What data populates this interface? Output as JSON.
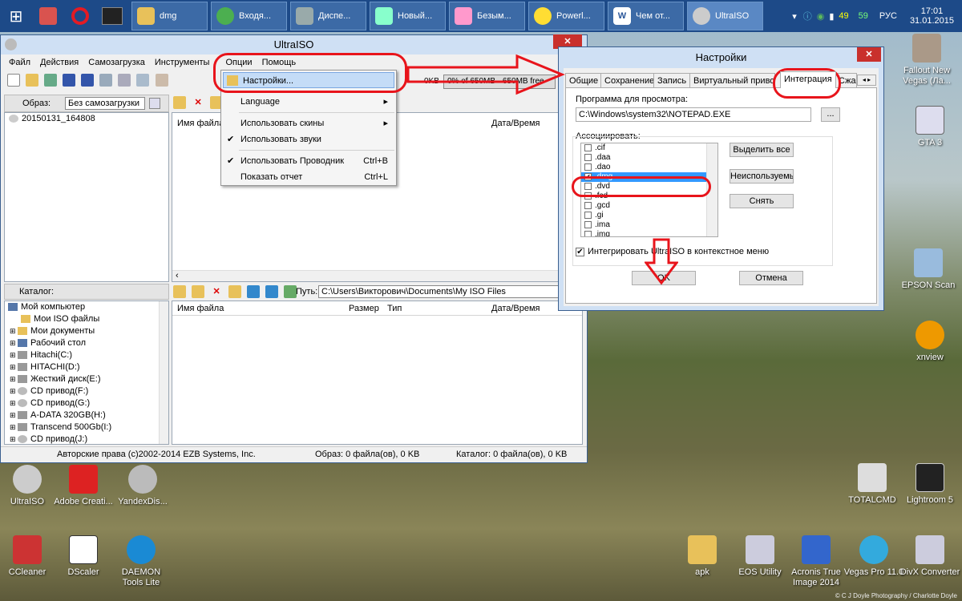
{
  "taskbar": {
    "tasks": [
      "dmg",
      "Входя...",
      "Диспе...",
      "Новый...",
      "Безым...",
      "Powerl...",
      "Чем от...",
      "UltraISO"
    ],
    "tray": {
      "lang": "РУС",
      "time": "17:01",
      "date": "31.01.2015",
      "n1": "49",
      "n2": "59"
    }
  },
  "ultraiso": {
    "title": "UltraISO",
    "menu": [
      "Файл",
      "Действия",
      "Самозагрузка",
      "Инструменты",
      "Опции",
      "Помощь"
    ],
    "image_label": "Образ:",
    "image_value": "Без самозагрузки",
    "size_label": "0KB",
    "size_bar": "0% of 650MB - 650MB free",
    "top_tree_item": "20150131_164808",
    "file_headers": [
      "Имя файла",
      "Размер",
      "Тип",
      "Дата/Время"
    ],
    "catalog_label": "Каталог:",
    "path_label": "Путь:",
    "path_value": "C:\\Users\\Викторович\\Documents\\My ISO Files",
    "tree": [
      "Мой компьютер",
      "Мои ISO файлы",
      "Мои документы",
      "Рабочий стол",
      "Hitachi(C:)",
      "HITACHI(D:)",
      "Жесткий диск(E:)",
      "CD привод(F:)",
      "CD привод(G:)",
      "A-DATA 320GB(H:)",
      "Transcend 500Gb(I:)",
      "CD привод(J:)"
    ],
    "status": {
      "copyright": "Авторские права (c)2002-2014 EZB Systems, Inc.",
      "image": "Образ: 0 файла(ов), 0 KB",
      "catalog": "Каталог: 0 файла(ов), 0 KB"
    }
  },
  "options_menu": {
    "settings": "Настройки...",
    "language": "Language",
    "use_skins": "Использовать скины",
    "use_sounds": "Использовать звуки",
    "use_explorer": "Использовать Проводник",
    "use_explorer_sc": "Ctrl+B",
    "show_report": "Показать отчет",
    "show_report_sc": "Ctrl+L"
  },
  "settings_dialog": {
    "title": "Настройки",
    "tabs": [
      "Общие",
      "Сохранение",
      "Запись",
      "Виртуальный привод",
      "Интеграция",
      "Сжа"
    ],
    "viewer_label": "Программа для просмотра:",
    "viewer_value": "C:\\Windows\\system32\\NOTEPAD.EXE",
    "browse": "...",
    "assoc_label": "Ассоциировать:",
    "extensions": [
      ".cif",
      ".daa",
      ".dao",
      ".dmg",
      ".dvd",
      ".fcd",
      ".gcd",
      ".gi",
      ".ima",
      ".img"
    ],
    "select_all": "Выделить все",
    "unused": "Неиспользуемы",
    "deselect": "Снять выделени",
    "integrate": "Интегрировать UltraISO в контекстное меню",
    "ok": "OK",
    "cancel": "Отмена"
  },
  "desktop": {
    "right": [
      "Fallout New Vegas (Ла...",
      "GTA 3",
      "EPSON Scan",
      "xnview",
      "TOTALCMD",
      "Lightroom 5"
    ],
    "bottom": [
      "UltraISO",
      "Adobe Creati...",
      "YandexDis...",
      "CCleaner",
      "DScaler",
      "DAEMON Tools Lite",
      "apk",
      "EOS Utility",
      "Acronis True Image 2014",
      "Vegas Pro 11.0",
      "DivX Converter"
    ],
    "credit": "© C J Doyle Photography / Charlotte Doyle"
  }
}
